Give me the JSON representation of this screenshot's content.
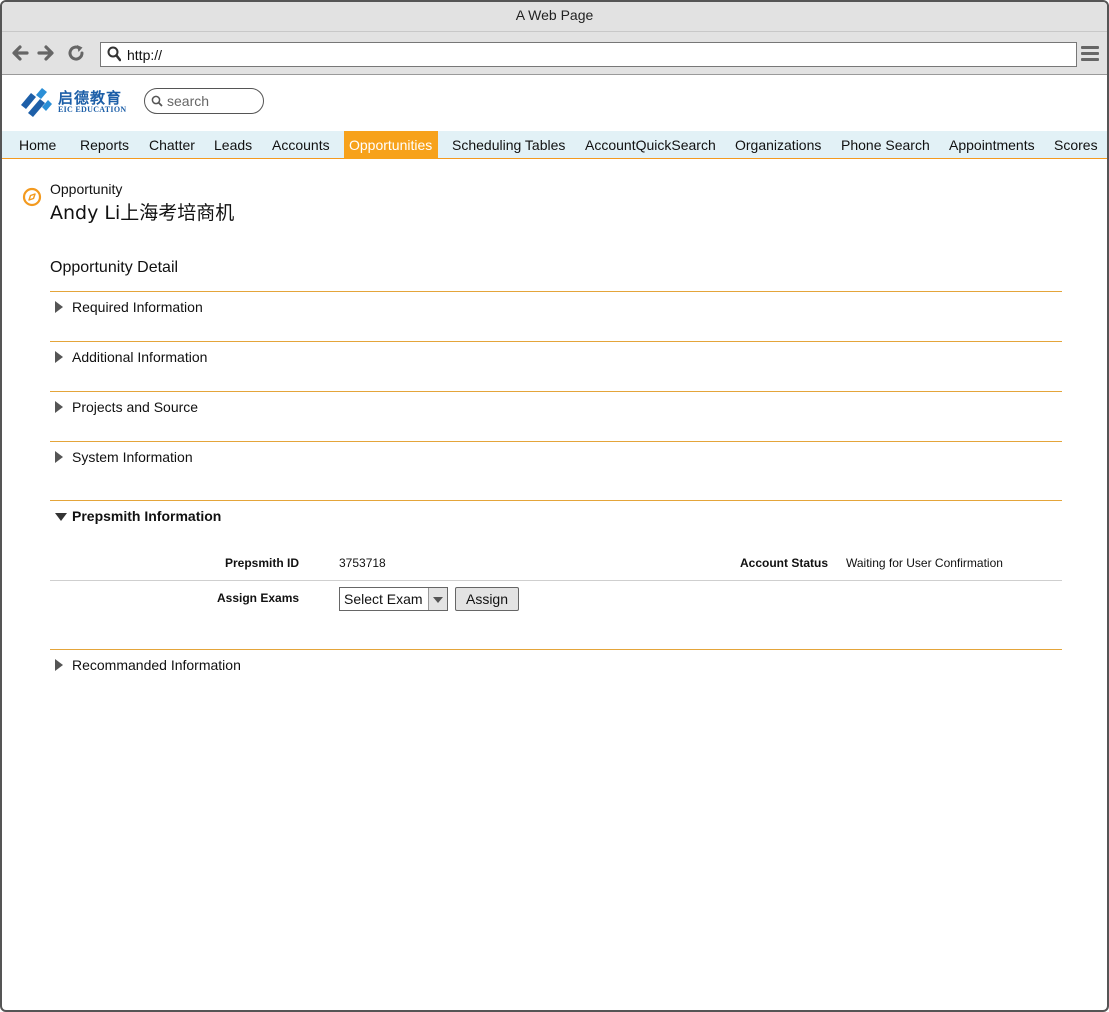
{
  "browser": {
    "window_title": "A Web Page",
    "url": "http://",
    "back_icon": "arrow-left-icon",
    "forward_icon": "arrow-right-icon",
    "reload_icon": "reload-icon",
    "menu_icon": "hamburger-menu-icon"
  },
  "header": {
    "logo_cn": "启德教育",
    "logo_en": "EIC EDUCATION",
    "search_placeholder": "search"
  },
  "nav": {
    "tabs": [
      {
        "label": "Home"
      },
      {
        "label": "Reports"
      },
      {
        "label": "Chatter"
      },
      {
        "label": "Leads"
      },
      {
        "label": "Accounts"
      },
      {
        "label": "Opportunities",
        "active": true
      },
      {
        "label": "Scheduling Tables"
      },
      {
        "label": "AccountQuickSearch"
      },
      {
        "label": "Organizations"
      },
      {
        "label": "Phone Search"
      },
      {
        "label": "Appointments"
      },
      {
        "label": "Scores"
      }
    ],
    "active_color": "#f7a21b",
    "bar_color": "#e2f1f6"
  },
  "page": {
    "breadcrumb": "Opportunity",
    "title": "Andy Li上海考培商机",
    "detail_heading": "Opportunity Detail"
  },
  "sections": [
    {
      "label": "Required Information",
      "expanded": false
    },
    {
      "label": "Additional Information",
      "expanded": false
    },
    {
      "label": "Projects and Source",
      "expanded": false
    },
    {
      "label": "System Information",
      "expanded": false
    },
    {
      "label": "Prepsmith Information",
      "expanded": true
    },
    {
      "label": "Recommanded Information",
      "expanded": false
    }
  ],
  "prepsmith": {
    "id_label": "Prepsmith ID",
    "id_value": "3753718",
    "status_label": "Account Status",
    "status_value": "Waiting for User Confirmation",
    "assign_label": "Assign Exams",
    "select_value": "Select Exam",
    "assign_button": "Assign"
  },
  "colors": {
    "section_rule": "#e4a53a",
    "logo_blue": "#1d5fa8"
  }
}
